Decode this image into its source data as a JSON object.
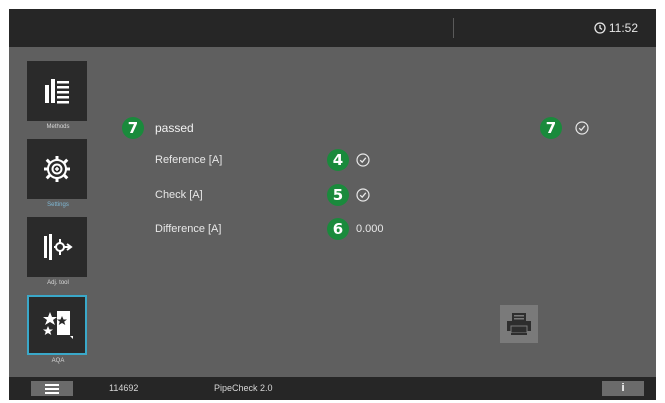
{
  "header": {
    "time": "11:52"
  },
  "sidebar": {
    "items": [
      {
        "label": "Methods",
        "icon": "list-icon"
      },
      {
        "label": "Settings",
        "icon": "gear-icon"
      },
      {
        "label": "Adj. tool",
        "icon": "adjust-icon"
      },
      {
        "label": "AQA",
        "icon": "stars-icon"
      }
    ]
  },
  "main": {
    "status_badge": "7",
    "status_text": "passed",
    "status_badge_right": "7",
    "rows": [
      {
        "label": "Reference [A]",
        "badge": "4",
        "value": ""
      },
      {
        "label": "Check [A]",
        "badge": "5",
        "value": ""
      },
      {
        "label": "Difference [A]",
        "badge": "6",
        "value": "0.000"
      }
    ]
  },
  "footer": {
    "serial": "114692",
    "app_name": "PipeCheck 2.0",
    "info_label": "i"
  },
  "colors": {
    "badge_green": "#1a8a3c",
    "selected_border": "#3aa8c9",
    "bar_bg": "#262626",
    "panel_bg": "#5f5f5f"
  }
}
